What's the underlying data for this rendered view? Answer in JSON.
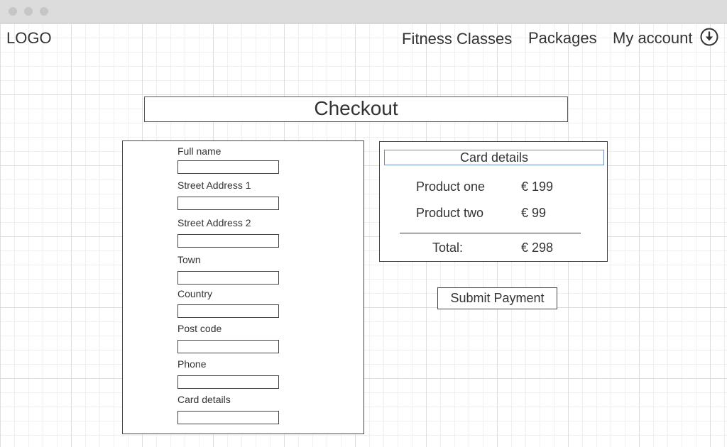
{
  "header": {
    "logo": "LOGO",
    "nav": {
      "fitness_classes": "Fitness Classes",
      "packages": "Packages",
      "my_account": "My account"
    },
    "account_icon": "download-circle-icon"
  },
  "page": {
    "title": "Checkout"
  },
  "form": {
    "full_name": {
      "label": "Full name",
      "value": ""
    },
    "street_address_1": {
      "label": "Street Address 1",
      "value": ""
    },
    "street_address_2": {
      "label": "Street Address 2",
      "value": ""
    },
    "town": {
      "label": "Town",
      "value": ""
    },
    "country": {
      "label": "Country",
      "value": ""
    },
    "post_code": {
      "label": "Post code",
      "value": ""
    },
    "phone": {
      "label": "Phone",
      "value": ""
    },
    "card_details": {
      "label": "Card details",
      "value": ""
    }
  },
  "summary": {
    "header": "Card details",
    "items": [
      {
        "name": "Product one",
        "price": "€ 199"
      },
      {
        "name": "Product two",
        "price": "€ 99"
      }
    ],
    "total_label": "Total:",
    "total_value": "€ 298"
  },
  "actions": {
    "submit_label": "Submit Payment"
  },
  "colors": {
    "text": "#333333",
    "border": "#444444",
    "highlight_border": "#6c8ebf",
    "window_bar": "#dcdcdc"
  }
}
